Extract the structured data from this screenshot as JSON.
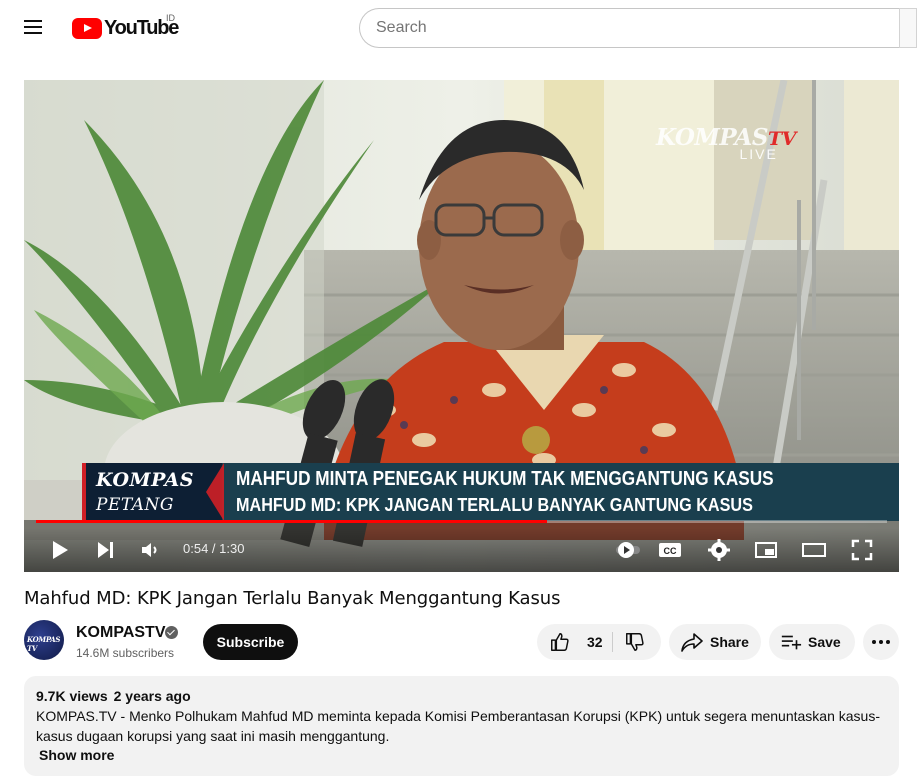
{
  "header": {
    "logo_text": "YouTube",
    "country_code": "ID",
    "search_placeholder": "Search",
    "menu_icon": "hamburger-menu-icon"
  },
  "player": {
    "watermark_brand": "KOMPAS",
    "watermark_tv": "TV",
    "watermark_live": "LIVE",
    "lower_third": {
      "brand_top": "KOMPAS",
      "brand_bottom": "PETANG",
      "headline": "MAHFUD MINTA PENEGAK HUKUM TAK MENGGANTUNG KASUS",
      "subheadline": "MAHFUD MD: KPK JANGAN TERLALU BANYAK GANTUNG KASUS"
    },
    "current_time": "0:54",
    "duration": "1:30",
    "progress_fraction": 0.6,
    "controls": [
      "play-icon",
      "next-icon",
      "volume-icon",
      "autoplay-toggle-icon",
      "captions-icon",
      "settings-icon",
      "miniplayer-icon",
      "theater-icon",
      "fullscreen-icon"
    ],
    "accent_color": "#ff0000"
  },
  "video": {
    "title": "Mahfud MD: KPK Jangan Terlalu Banyak Menggantung Kasus"
  },
  "channel": {
    "name": "KOMPASTV",
    "avatar_text": "KOMPAS TV",
    "subscribers": "14.6M subscribers",
    "subscribe_label": "Subscribe"
  },
  "actions": {
    "like_count": "32",
    "share_label": "Share",
    "save_label": "Save"
  },
  "description": {
    "views": "9.7K views",
    "age": "2 years ago",
    "text_line1": "KOMPAS.TV - Menko Polhukam  Mahfud MD meminta kepada Komisi Pemberantasan Korupsi (KPK)  untuk segera menuntaskan kasus-",
    "text_line2": "kasus dugaan korupsi yang saat ini masih menggantung.",
    "show_more": "Show more"
  }
}
